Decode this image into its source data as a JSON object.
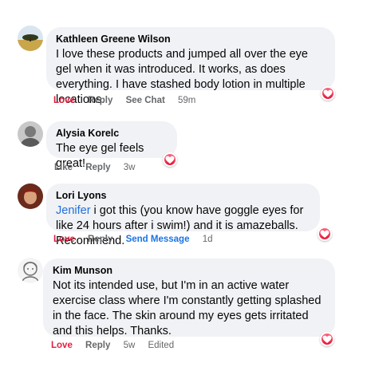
{
  "colors": {
    "bubble_bg": "#f0f2f5",
    "love": "#e41e3f",
    "link": "#1b74e4",
    "mention": "#216fdb",
    "muted": "#65676b"
  },
  "comments": [
    {
      "author": "Kathleen Greene Wilson",
      "text": "I love these products and jumped all over the eye gel when it was introduced. It works, as does everything. I have stashed body lotion in multiple locations.",
      "reaction_icon": "heart-icon",
      "actions": {
        "react": "Love",
        "reply": "Reply",
        "extra": "See Chat",
        "time": "59m"
      }
    },
    {
      "author": "Alysia Korelc",
      "text": "The eye gel feels great!",
      "reaction_icon": "heart-icon",
      "actions": {
        "react": "Like",
        "reply": "Reply",
        "time": "3w"
      }
    },
    {
      "author": "Lori Lyons",
      "mention": "Jenifer",
      "text": " i got this (you know have goggle eyes for like 24 hours after i swim!) and it is amazeballs. Recommend.",
      "reaction_icon": "heart-icon",
      "actions": {
        "react": "Love",
        "reply": "Reply",
        "extra": "Send Message",
        "time": "1d"
      }
    },
    {
      "author": "Kim Munson",
      "text": "Not its intended use, but I'm in an active water exercise class where I'm constantly getting splashed in the face. The skin around my eyes gets irritated and this helps. Thanks.",
      "reaction_icon": "heart-icon",
      "actions": {
        "react": "Love",
        "reply": "Reply",
        "time": "5w",
        "edited": "Edited"
      }
    }
  ]
}
